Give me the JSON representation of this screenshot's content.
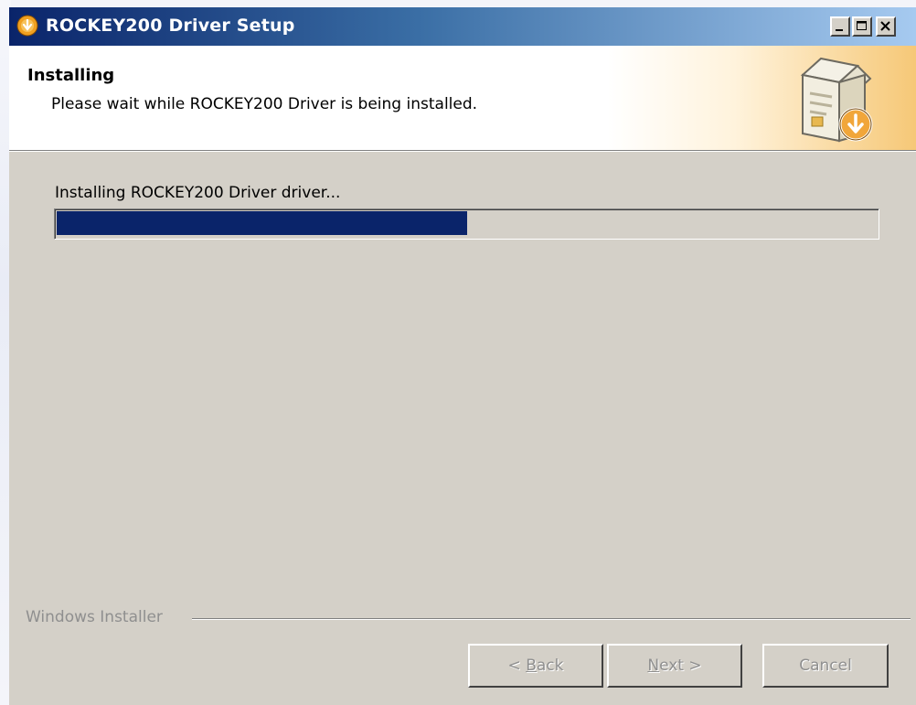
{
  "window": {
    "title": "ROCKEY200 Driver Setup",
    "title_icon": "installer-disc-icon",
    "controls": {
      "minimize_icon": "minimize-icon",
      "maximize_icon": "maximize-icon",
      "close_icon": "close-icon"
    }
  },
  "header": {
    "title": "Installing",
    "subtitle": "Please wait while ROCKEY200 Driver is being installed.",
    "icon": "box-install-icon"
  },
  "main": {
    "status_text": "Installing ROCKEY200 Driver driver...",
    "progress_percent": 50
  },
  "footer": {
    "group_label": "Windows Installer",
    "buttons": {
      "back": {
        "pre": "< ",
        "accel": "B",
        "post": "ack",
        "enabled": false
      },
      "next": {
        "pre": "",
        "accel": "N",
        "post": "ext >",
        "enabled": false
      },
      "cancel": {
        "label": "Cancel",
        "enabled": false
      }
    }
  },
  "colors": {
    "title_gradient_start": "#0a246a",
    "title_gradient_end": "#a6caf0",
    "progress_fill": "#0a246a",
    "dialog_face": "#d4d0c8",
    "disabled_text": "#8f8f8f"
  }
}
